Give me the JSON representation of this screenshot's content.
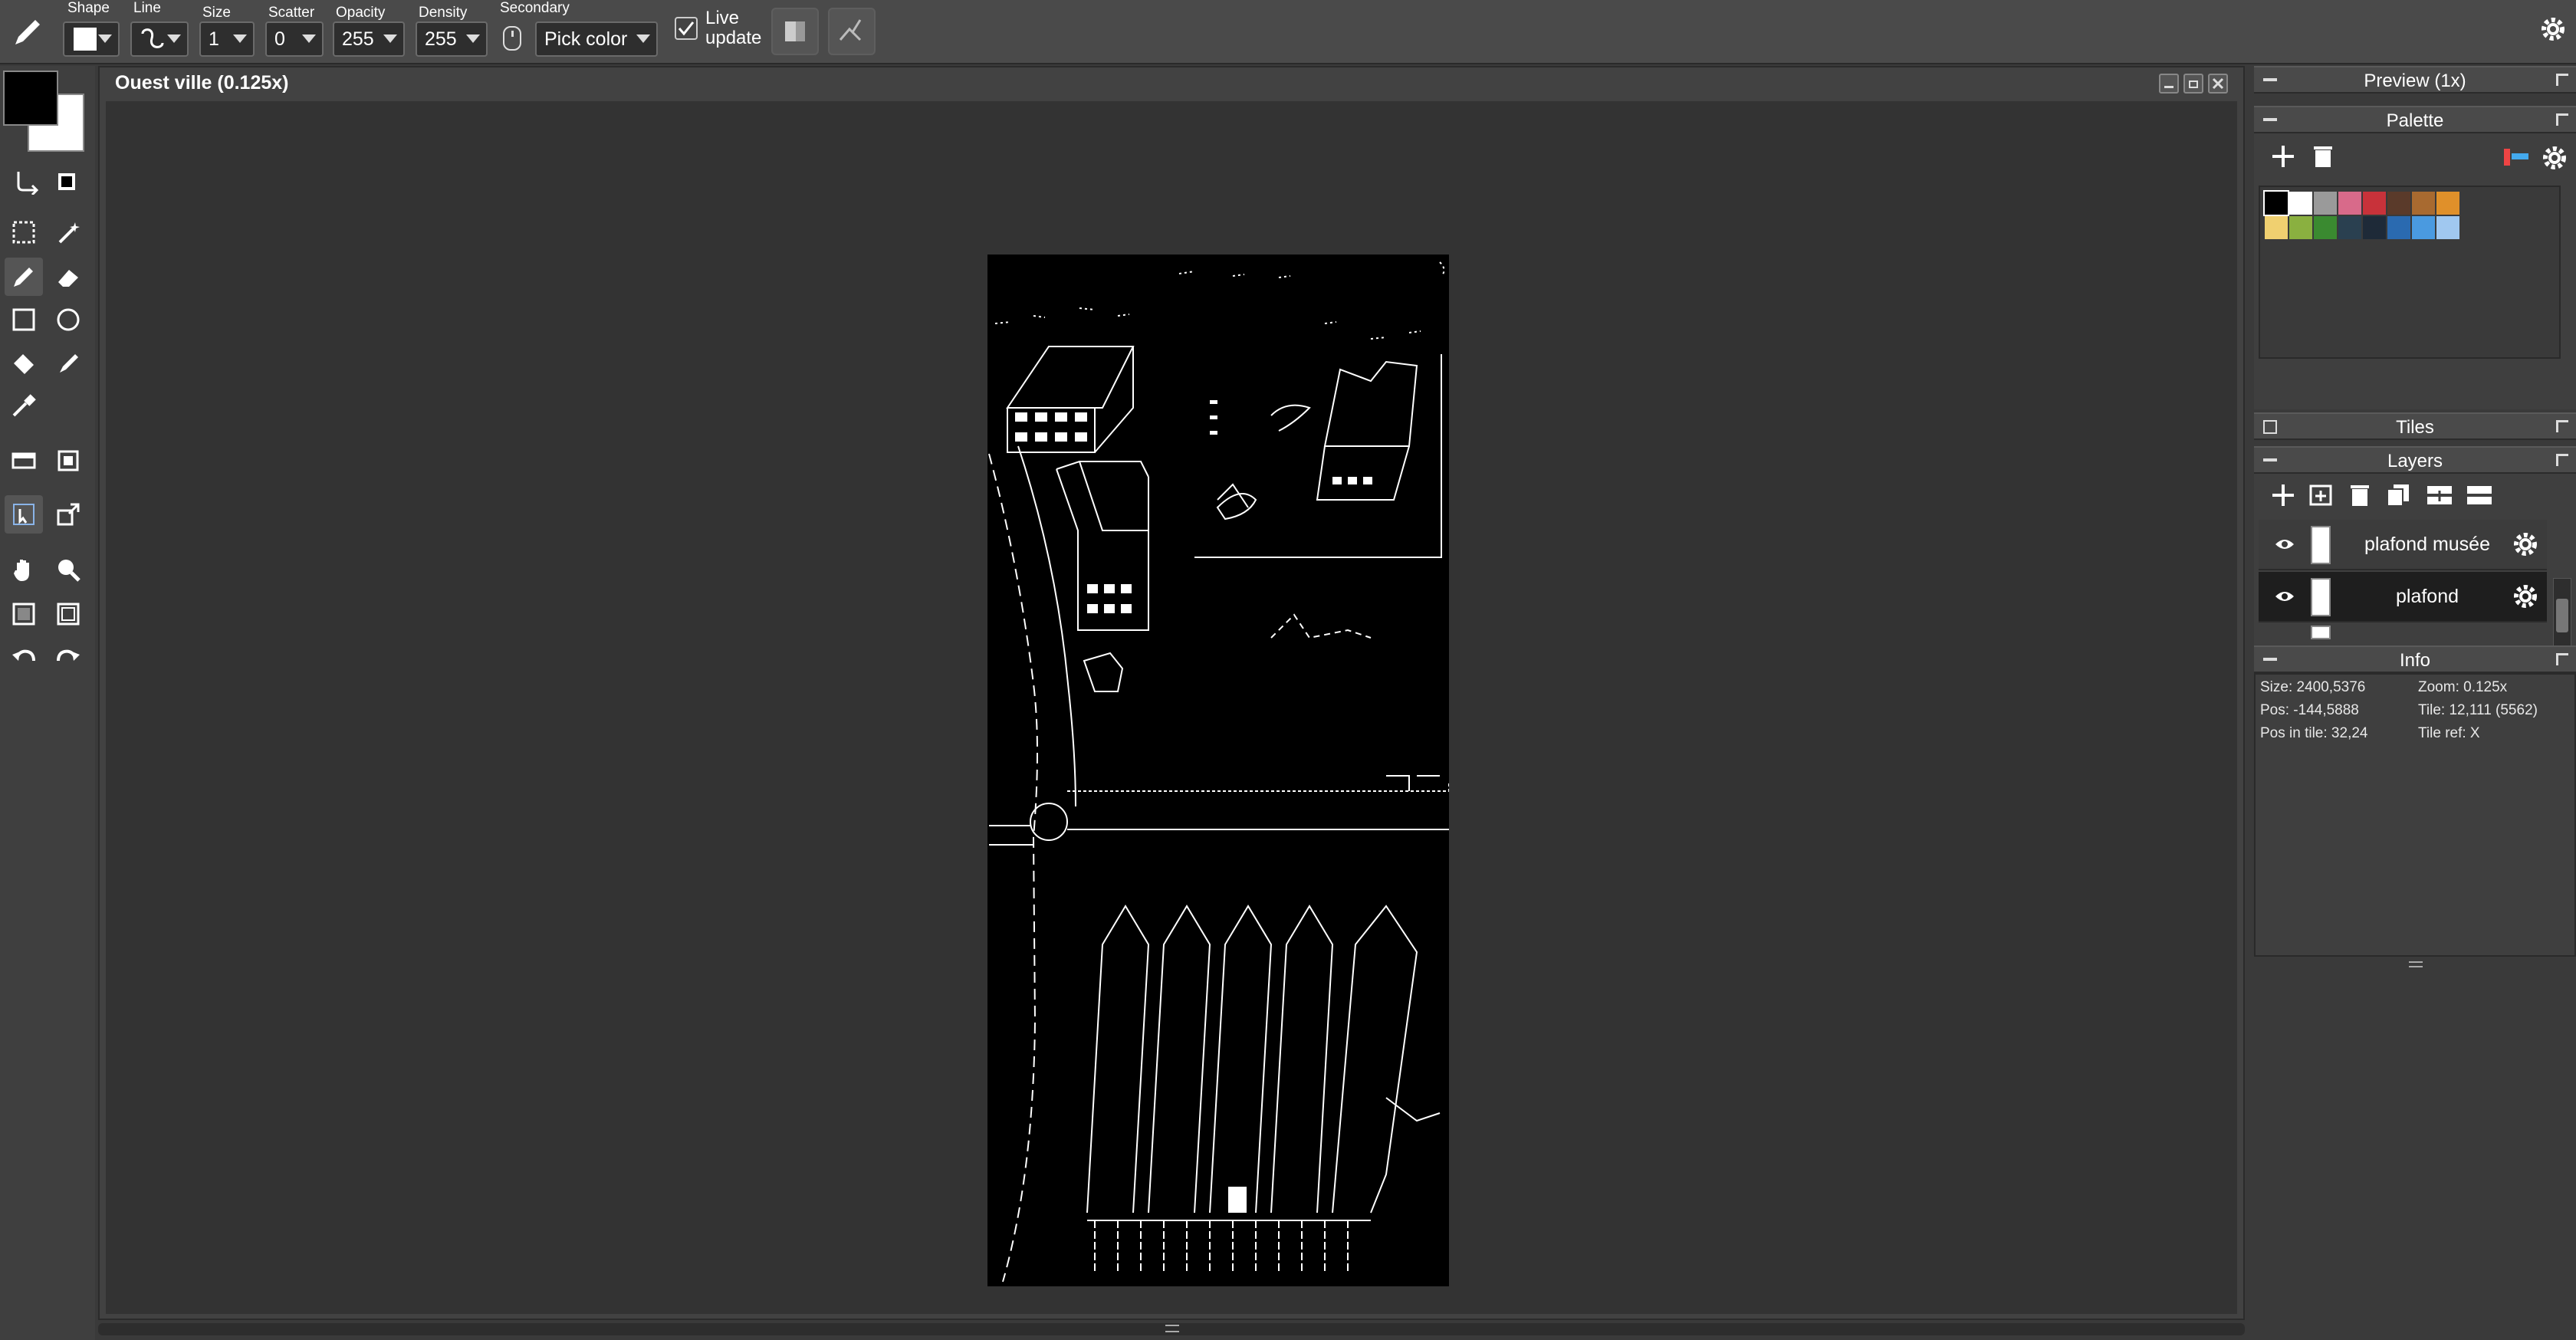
{
  "toolbar": {
    "shape_label": "Shape",
    "line_label": "Line",
    "size_label": "Size",
    "size_value": "1",
    "scatter_label": "Scatter",
    "scatter_value": "0",
    "opacity_label": "Opacity",
    "opacity_value": "255",
    "density_label": "Density",
    "density_value": "255",
    "secondary_label": "Secondary",
    "secondary_value": "Pick color",
    "live_update_label_1": "Live",
    "live_update_label_2": "update",
    "live_update_checked": true
  },
  "colors": {
    "primary": "#000000",
    "secondary": "#ffffff"
  },
  "document": {
    "title": "Ouest ville   (0.125x)"
  },
  "panels": {
    "preview_title": "Preview (1x)",
    "palette_title": "Palette",
    "tiles_title": "Tiles",
    "layers_title": "Layers",
    "info_title": "Info"
  },
  "palette": {
    "row1": [
      "#000000",
      "#ffffff",
      "#9a9a9a",
      "#d86a8a",
      "#c8323a",
      "#5a3a2a",
      "#a86a30",
      "#e0902a"
    ],
    "row2": [
      "#f0d070",
      "#8ab040",
      "#3a8a30",
      "#2a4050",
      "#1e2a38",
      "#2a6ab0",
      "#4a9ae0",
      "#a0c8f0"
    ]
  },
  "layers": [
    {
      "name": "plafond musée",
      "visible": true,
      "selected": false
    },
    {
      "name": "plafond",
      "visible": true,
      "selected": true
    }
  ],
  "info": {
    "size": "Size: 2400,5376",
    "zoom": "Zoom: 0.125x",
    "pos": "Pos: -144,5888",
    "tile": "Tile: 12,111 (5562)",
    "pos_in_tile": "Pos in tile: 32,24",
    "tile_ref": "Tile ref: X"
  }
}
